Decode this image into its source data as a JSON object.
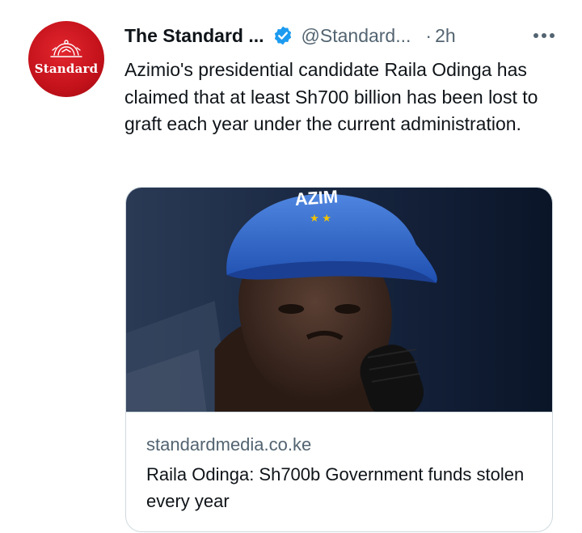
{
  "tweet": {
    "display_name": "The Standard ...",
    "handle": "@Standard...",
    "separator": "·",
    "time": "2h",
    "text": "Azimio's presidential candidate Raila Odinga has claimed that at least Sh700 billion has been lost to graft each year under the current administration."
  },
  "avatar": {
    "logo_text": "Standard"
  },
  "card": {
    "image_caption_text": "AZIM",
    "domain": "standardmedia.co.ke",
    "title": "Raila Odinga: Sh700b Government funds stolen every year"
  },
  "icons": {
    "verified": "verified-badge-icon",
    "more": "more-dots-icon"
  },
  "colors": {
    "brand_red": "#c4121b",
    "verified_blue": "#1d9bf0",
    "text_primary": "#0f1419",
    "text_secondary": "#536471",
    "border": "#cfd9de"
  }
}
